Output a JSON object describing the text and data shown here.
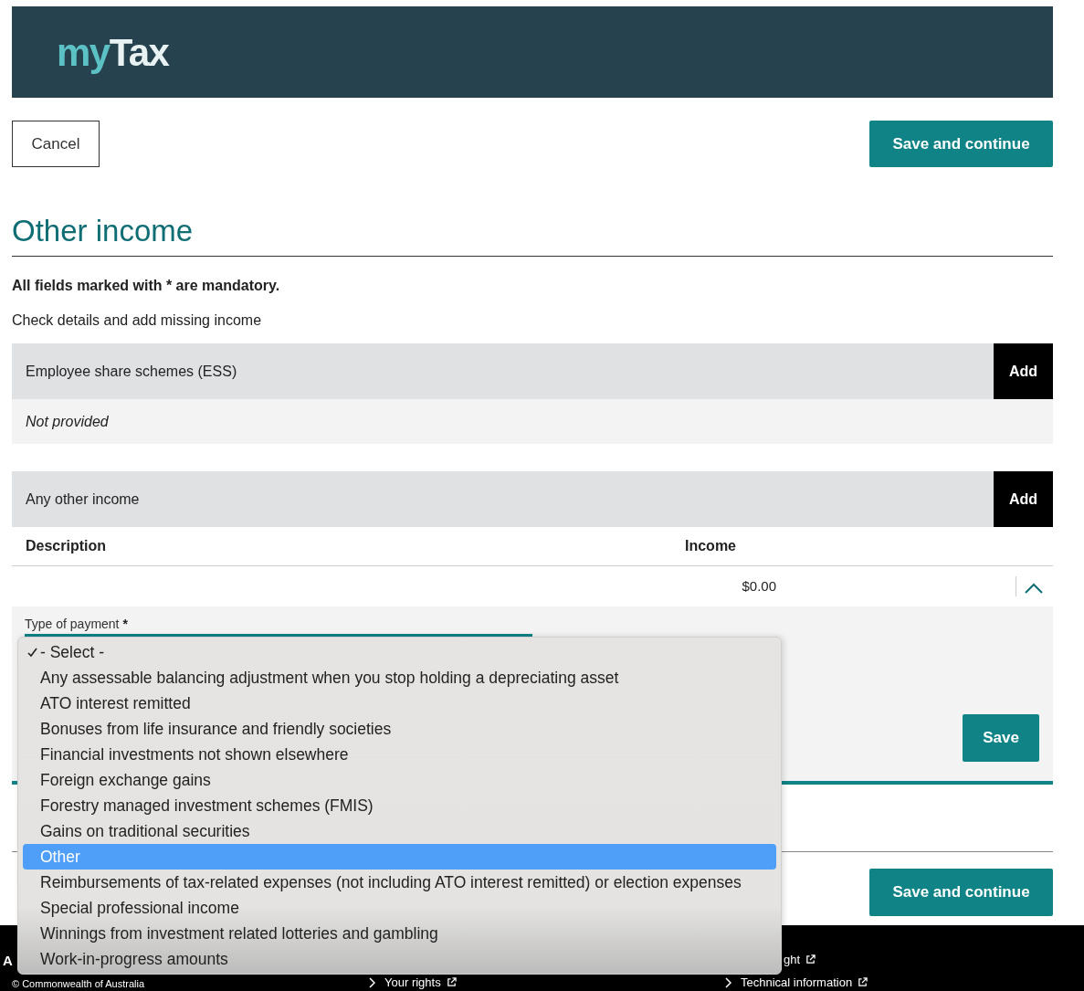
{
  "header": {
    "logo": {
      "prefix": "my",
      "suffix": "Tax"
    }
  },
  "top_actions": {
    "cancel": "Cancel",
    "save_continue": "Save and continue"
  },
  "title": "Other income",
  "mandatory_note": "All fields marked with * are mandatory.",
  "intro": "Check details and add missing income",
  "sections": [
    {
      "title": "Employee share schemes (ESS)",
      "add": "Add",
      "empty": "Not provided"
    },
    {
      "title": "Any other income",
      "add": "Add",
      "table": {
        "columns": [
          "Description",
          "Income"
        ],
        "rows": [
          {
            "description": "",
            "income": "$0.00",
            "expanded": true
          }
        ]
      }
    }
  ],
  "form": {
    "label": "Type of payment",
    "required_mark": "*",
    "save": "Save"
  },
  "dropdown": [
    {
      "label": "- Select -",
      "selected": true,
      "highlighted": false
    },
    {
      "label": "Any assessable balancing adjustment when you stop holding a depreciating asset",
      "selected": false,
      "highlighted": false
    },
    {
      "label": "ATO interest remitted",
      "selected": false,
      "highlighted": false
    },
    {
      "label": "Bonuses from life insurance and friendly societies",
      "selected": false,
      "highlighted": false
    },
    {
      "label": "Financial investments not shown elsewhere",
      "selected": false,
      "highlighted": false
    },
    {
      "label": "Foreign exchange gains",
      "selected": false,
      "highlighted": false
    },
    {
      "label": "Forestry managed investment schemes (FMIS)",
      "selected": false,
      "highlighted": false
    },
    {
      "label": "Gains on traditional securities",
      "selected": false,
      "highlighted": false
    },
    {
      "label": "Other",
      "selected": false,
      "highlighted": true
    },
    {
      "label": "Reimbursements of tax-related expenses (not including ATO interest remitted) or election expenses",
      "selected": false,
      "highlighted": false
    },
    {
      "label": "Special professional income",
      "selected": false,
      "highlighted": false
    },
    {
      "label": "Winnings from investment related lotteries and gambling",
      "selected": false,
      "highlighted": false
    },
    {
      "label": "Work-in-progress amounts",
      "selected": false,
      "highlighted": false
    }
  ],
  "bottom_actions": {
    "save_continue": "Save and continue"
  },
  "footer": {
    "heading": "A",
    "copyright": "© Commonwealth of Australia",
    "links": [
      {
        "label": "ght"
      },
      {
        "label": "Your rights"
      },
      {
        "label": "Technical information"
      }
    ]
  }
}
